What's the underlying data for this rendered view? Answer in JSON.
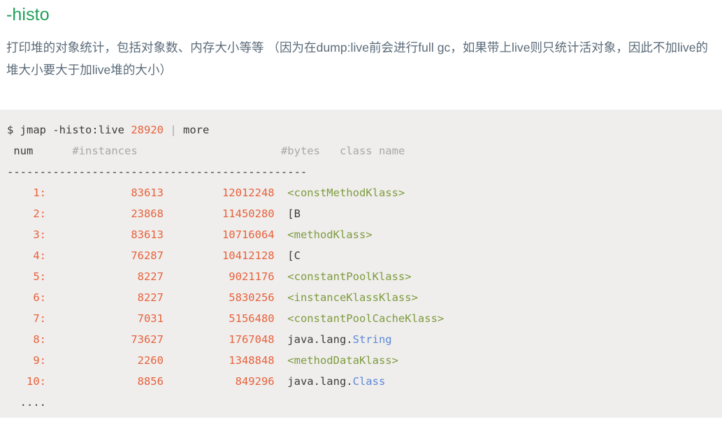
{
  "heading": "-histo",
  "paragraph": "打印堆的对象统计，包括对象数、内存大小等等 （因为在dump:live前会进行full gc，如果带上live则只统计活对象，因此不加live的堆大小要大于加live堆的大小）",
  "colors": {
    "heading_green": "#22a05b",
    "paragraph_slate": "#5b6b79",
    "code_background": "#efeeec",
    "number_orange": "#e8613c",
    "comment_gray": "#aaa8a5",
    "class_green": "#7e9b3f",
    "type_blue": "#5d88d8",
    "plain_text": "#3c3c3c"
  },
  "terminal": {
    "prompt": "$",
    "command": " jmap -histo:live ",
    "pid": "28920",
    "pipe": " | ",
    "pager": "more",
    "columns": {
      "num": " num",
      "instances": "#instances",
      "bytes": "#bytes",
      "class_name": "class name"
    },
    "separator": "----------------------------------------------",
    "rows": [
      {
        "num": "1:",
        "instances": "83613",
        "bytes": "12012248",
        "class_prefix": "",
        "class_name": "<constMethodKlass>",
        "class_style": "green"
      },
      {
        "num": "2:",
        "instances": "23868",
        "bytes": "11450280",
        "class_prefix": "",
        "class_name": "[B",
        "class_style": "plain"
      },
      {
        "num": "3:",
        "instances": "83613",
        "bytes": "10716064",
        "class_prefix": "",
        "class_name": "<methodKlass>",
        "class_style": "green"
      },
      {
        "num": "4:",
        "instances": "76287",
        "bytes": "10412128",
        "class_prefix": "",
        "class_name": "[C",
        "class_style": "plain"
      },
      {
        "num": "5:",
        "instances": "8227",
        "bytes": "9021176",
        "class_prefix": "",
        "class_name": "<constantPoolKlass>",
        "class_style": "green"
      },
      {
        "num": "6:",
        "instances": "8227",
        "bytes": "5830256",
        "class_prefix": "",
        "class_name": "<instanceKlassKlass>",
        "class_style": "green"
      },
      {
        "num": "7:",
        "instances": "7031",
        "bytes": "5156480",
        "class_prefix": "",
        "class_name": "<constantPoolCacheKlass>",
        "class_style": "green"
      },
      {
        "num": "8:",
        "instances": "73627",
        "bytes": "1767048",
        "class_prefix": "java.lang.",
        "class_name": "String",
        "class_style": "blue"
      },
      {
        "num": "9:",
        "instances": "2260",
        "bytes": "1348848",
        "class_prefix": "",
        "class_name": "<methodDataKlass>",
        "class_style": "green"
      },
      {
        "num": "10:",
        "instances": "8856",
        "bytes": "849296",
        "class_prefix": "java.lang.",
        "class_name": "Class",
        "class_style": "blue"
      }
    ],
    "ellipsis": "...."
  }
}
